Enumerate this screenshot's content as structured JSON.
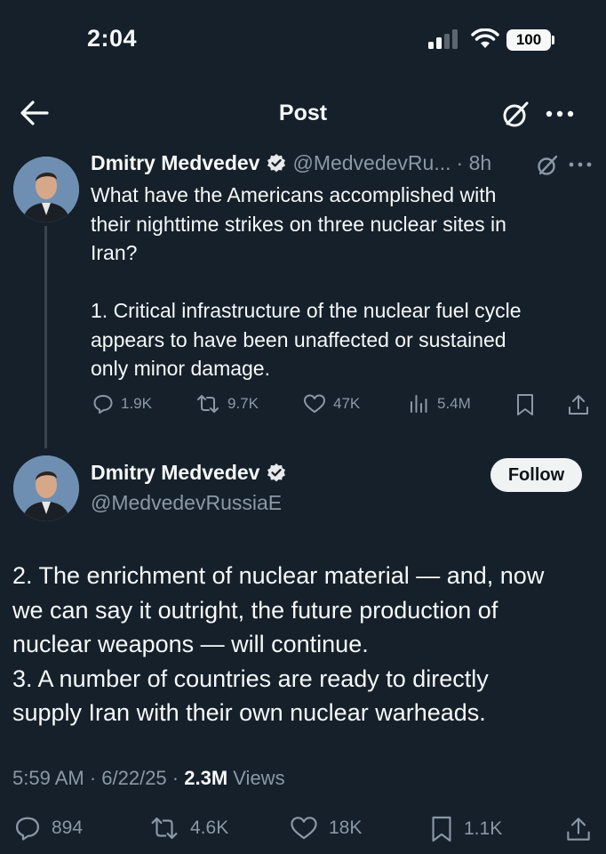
{
  "status_bar": {
    "time": "2:04",
    "battery": "100"
  },
  "header": {
    "title": "Post"
  },
  "thread_tweet": {
    "name": "Dmitry Medvedev",
    "handle": "@MedvedevRu...",
    "time": "· 8h",
    "text": "What have the Americans accomplished with\ntheir nighttime strikes on three nuclear sites in\nIran?\n\n1. Critical infrastructure of the nuclear fuel cycle\nappears to have been unaffected or sustained\nonly minor damage.",
    "replies": "1.9K",
    "reposts": "9.7K",
    "likes": "47K",
    "views": "5.4M"
  },
  "main_tweet": {
    "name": "Dmitry Medvedev",
    "handle": "@MedvedevRussiaE",
    "follow_label": "Follow",
    "text": "2. The enrichment of nuclear material — and, now\nwe can say it outright, the future production of\nnuclear weapons — will continue.\n3. A number of countries are ready to directly\nsupply Iran with their own nuclear warheads.",
    "timestamp": "5:59 AM · 6/22/25 ·",
    "views_count": "2.3M",
    "views_label": "Views",
    "replies": "894",
    "reposts": "4.6K",
    "likes": "18K",
    "bookmarks": "1.1K"
  },
  "colors": {
    "background": "#15202b",
    "text": "#f7f9f9",
    "secondary": "#8b98a5",
    "verified": "#1d9bf0"
  },
  "icons": [
    "back-arrow-icon",
    "grok-icon",
    "more-icon",
    "verified-icon",
    "reply-icon",
    "repost-icon",
    "like-icon",
    "views-icon",
    "bookmark-icon",
    "share-icon"
  ]
}
